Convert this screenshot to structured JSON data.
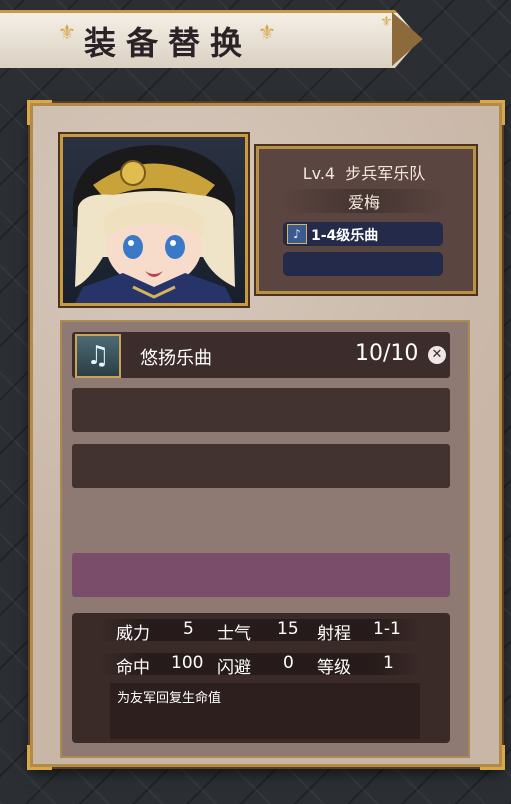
{
  "header": {
    "title": "装备替换"
  },
  "unit": {
    "level": "Lv.4",
    "class": "步兵军乐队",
    "name": "爱梅",
    "equipment": {
      "icon": "music-sheet-icon",
      "label": "1-4级乐曲"
    }
  },
  "skill": {
    "icon": "music-note-icon",
    "name": "悠扬乐曲",
    "count": "10/10"
  },
  "stats": [
    {
      "label": "威力",
      "value": "5"
    },
    {
      "label": "士气",
      "value": "15"
    },
    {
      "label": "射程",
      "value": "1-1"
    },
    {
      "label": "命中",
      "value": "100"
    },
    {
      "label": "闪避",
      "value": "0"
    },
    {
      "label": "等级",
      "value": "1"
    }
  ],
  "description": "为友军回复生命值",
  "colors": {
    "gold": "#c89a44",
    "purple_slot": "#7a4e6a",
    "equip_bar": "#232a4a"
  }
}
